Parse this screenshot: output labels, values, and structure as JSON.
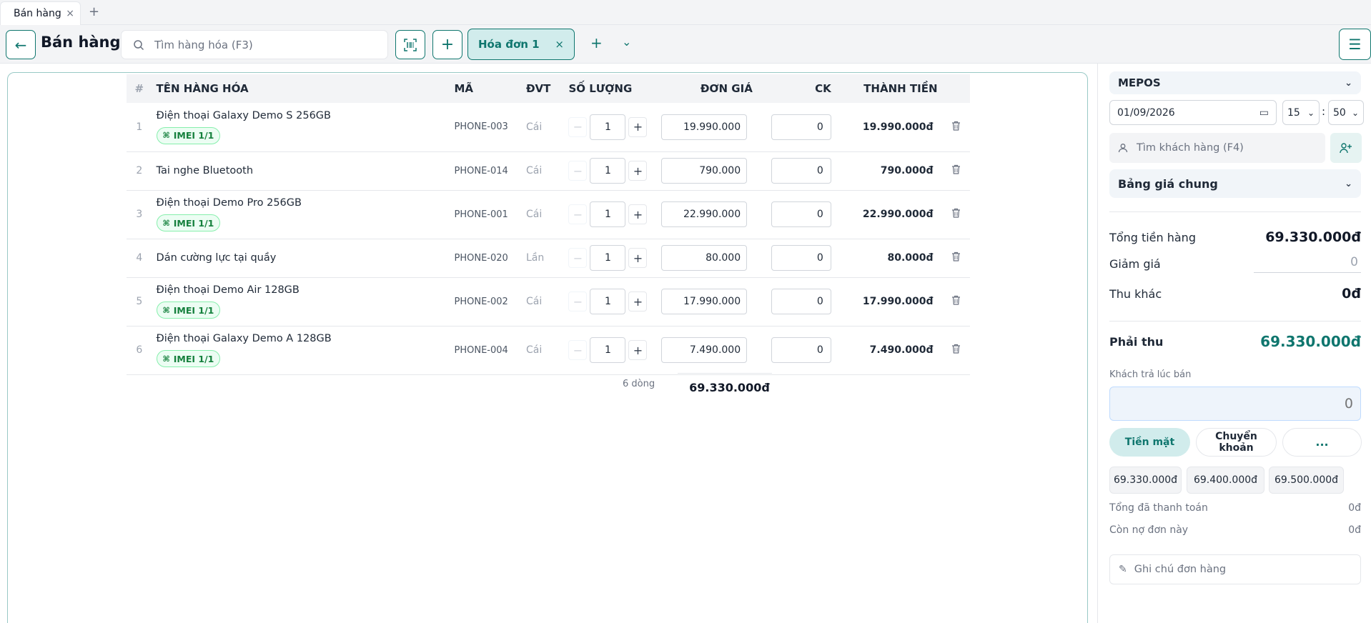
{
  "browser_tab": {
    "title": "Bán hàng",
    "close": "×",
    "new_tab": "+"
  },
  "header": {
    "back_icon": "←",
    "title": "Bán hàng",
    "search_placeholder": "Tìm hàng hóa (F3)",
    "add": "+",
    "invoice_tab": "Hóa đơn 1",
    "invoice_close": "×",
    "new_invoice": "+",
    "invoice_dropdown": "⌄",
    "menu": "☰"
  },
  "table": {
    "headers": {
      "idx": "#",
      "name": "TÊN HÀNG HÓA",
      "code": "MÃ",
      "unit": "ĐVT",
      "qty": "SỐ LƯỢNG",
      "price": "ĐƠN GIÁ",
      "discount": "CK",
      "total": "THÀNH TIỀN"
    },
    "rows": [
      {
        "idx": "1",
        "name": "Điện thoại Galaxy Demo S 256GB",
        "imei": "IMEI 1/1",
        "code": "PHONE-003",
        "unit": "Cái",
        "qty": "1",
        "price": "19.990.000",
        "discount": "0",
        "total": "19.990.000đ"
      },
      {
        "idx": "2",
        "name": "Tai nghe Bluetooth",
        "imei": "",
        "code": "PHONE-014",
        "unit": "Cái",
        "qty": "1",
        "price": "790.000",
        "discount": "0",
        "total": "790.000đ"
      },
      {
        "idx": "3",
        "name": "Điện thoại Demo Pro 256GB",
        "imei": "IMEI 1/1",
        "code": "PHONE-001",
        "unit": "Cái",
        "qty": "1",
        "price": "22.990.000",
        "discount": "0",
        "total": "22.990.000đ"
      },
      {
        "idx": "4",
        "name": "Dán cường lực tại quầy",
        "imei": "",
        "code": "PHONE-020",
        "unit": "Lần",
        "qty": "1",
        "price": "80.000",
        "discount": "0",
        "total": "80.000đ"
      },
      {
        "idx": "5",
        "name": "Điện thoại Demo Air 128GB",
        "imei": "IMEI 1/1",
        "code": "PHONE-002",
        "unit": "Cái",
        "qty": "1",
        "price": "17.990.000",
        "discount": "0",
        "total": "17.990.000đ"
      },
      {
        "idx": "6",
        "name": "Điện thoại Galaxy Demo A 128GB",
        "imei": "IMEI 1/1",
        "code": "PHONE-004",
        "unit": "Cái",
        "qty": "1",
        "price": "7.490.000",
        "discount": "0",
        "total": "7.490.000đ"
      }
    ],
    "footer": {
      "line_count": "6 dòng",
      "sum": "69.330.000đ"
    }
  },
  "sidebar": {
    "store": "MEPOS",
    "date": "01/09/2026",
    "hour": "15",
    "minute": "50",
    "time_sep": ":",
    "customer_placeholder": "Tìm khách hàng (F4)",
    "price_list": "Bảng giá chung",
    "goods_total_label": "Tổng tiền hàng",
    "goods_total": "69.330.000đ",
    "discount_label": "Giảm giá",
    "discount": "0",
    "other_label": "Thu khác",
    "other": "0đ",
    "due_label": "Phải thu",
    "due": "69.330.000đ",
    "paid_label": "Khách trả lúc bán",
    "paid_placeholder": "0",
    "pay_cash": "Tiền mặt",
    "pay_transfer": "Chuyển khoản",
    "pay_more": "...",
    "quick_amounts": [
      "69.330.000đ",
      "69.400.000đ",
      "69.500.000đ"
    ],
    "total_paid_label": "Tổng đã thanh toán",
    "total_paid": "0đ",
    "remaining_label": "Còn nợ đơn này",
    "remaining": "0đ",
    "note_placeholder": "Ghi chú đơn hàng"
  },
  "colors": {
    "accent": "#0f766e",
    "accent_light": "#d1ecec",
    "imei_green": "#15803d"
  }
}
